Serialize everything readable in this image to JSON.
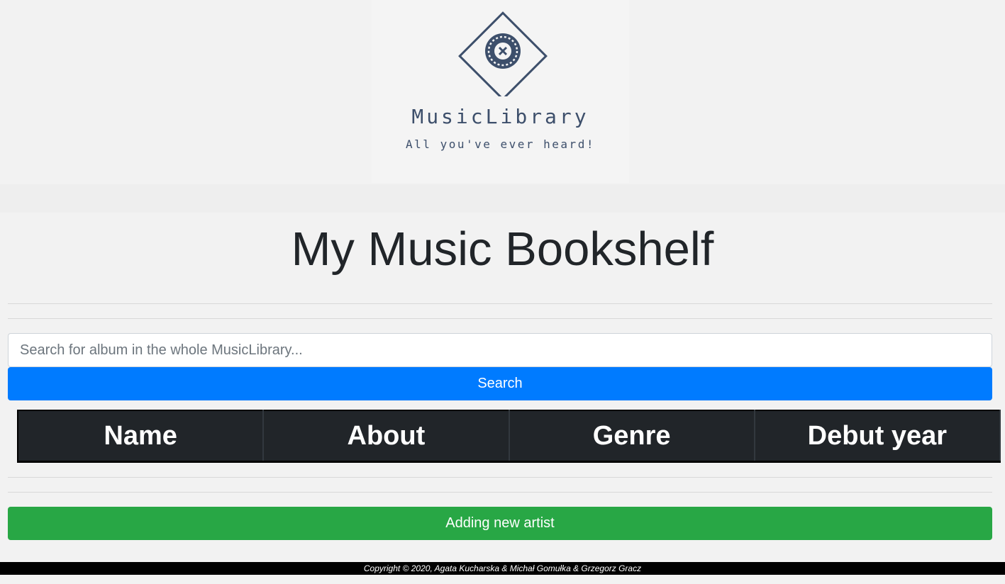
{
  "header": {
    "brand": "MusicLibrary",
    "tagline": "All you've ever heard!",
    "logo_icon": "vinyl-diamond-logo-icon",
    "brand_color": "#3d4f6b"
  },
  "main": {
    "title": "My Music Bookshelf",
    "search": {
      "placeholder": "Search for album in the whole MusicLibrary...",
      "value": "",
      "button_label": "Search",
      "button_color": "#007bff"
    },
    "table": {
      "columns": [
        "Name",
        "About",
        "Genre",
        "Debut year"
      ],
      "rows": []
    },
    "add_artist_label": "Adding new artist",
    "add_button_color": "#28a745"
  },
  "footer": {
    "copyright": "Copyright © 2020, Agata Kucharska & Michał Gomułka & Grzegorz Gracz"
  }
}
